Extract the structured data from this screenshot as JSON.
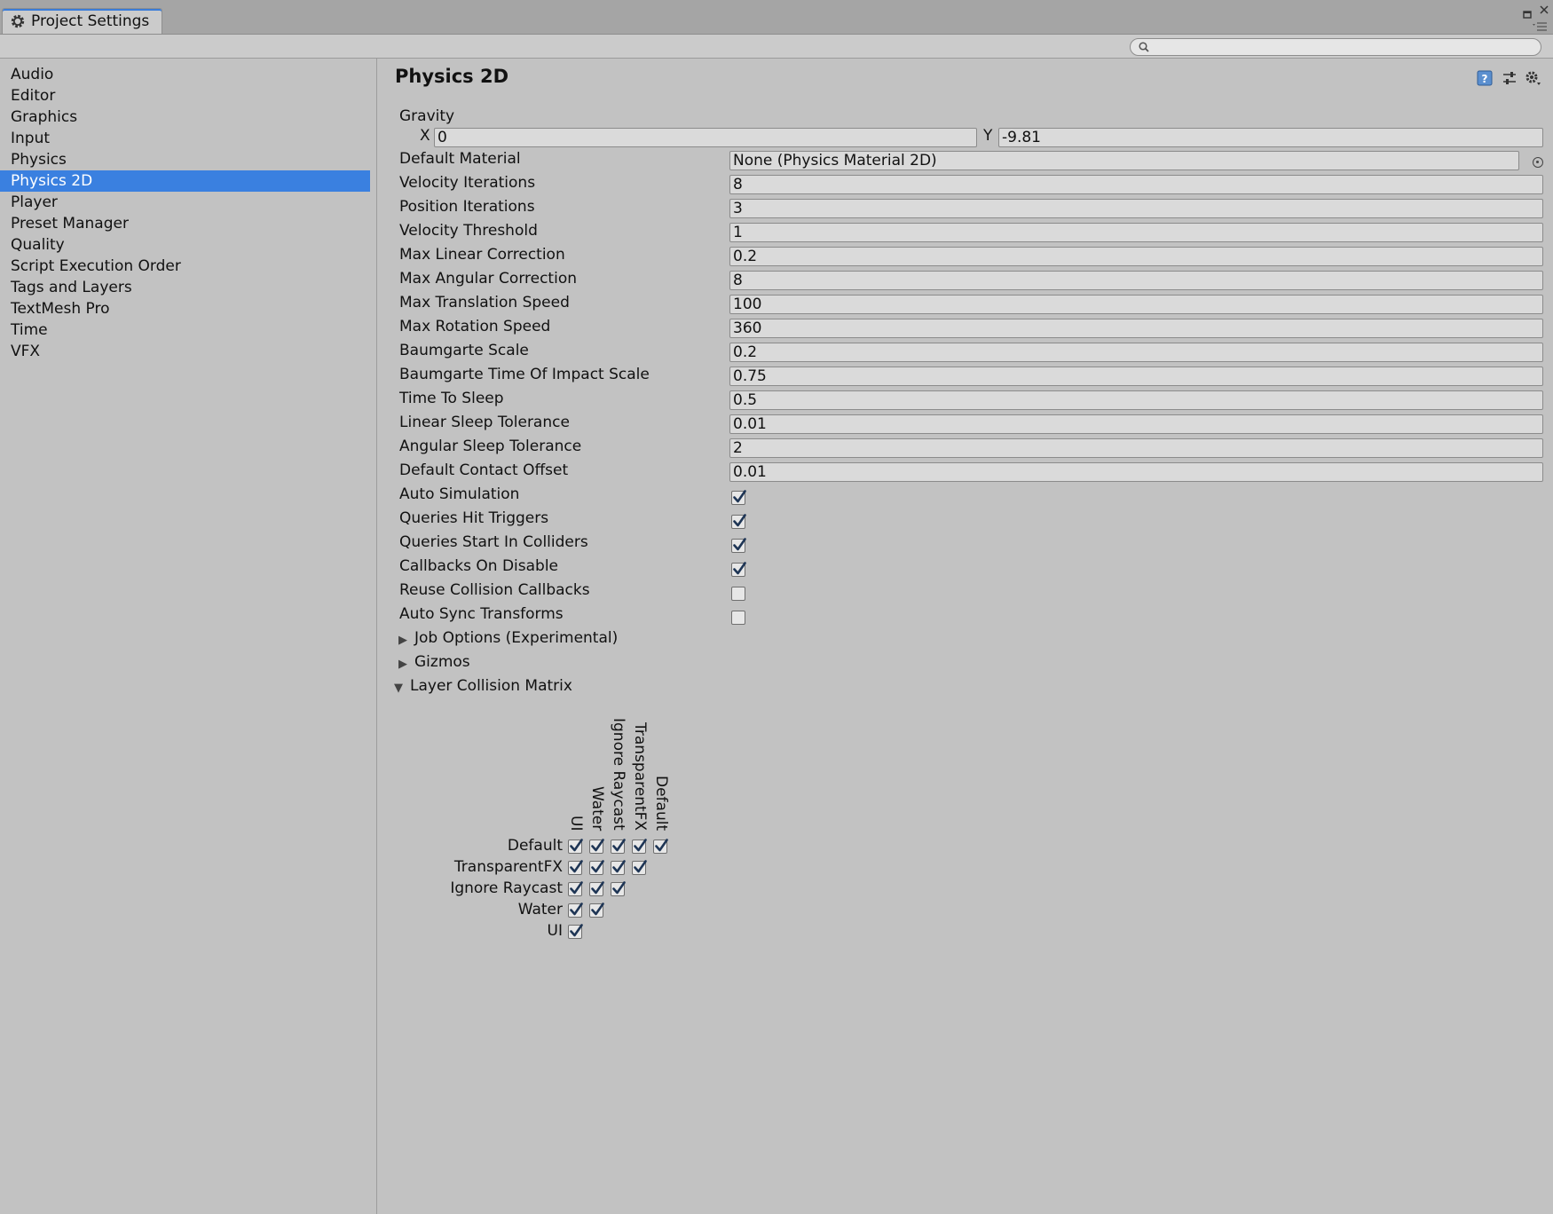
{
  "window": {
    "tab_title": "Project Settings",
    "search": {
      "value": "",
      "placeholder": ""
    }
  },
  "sidebar": {
    "items": [
      {
        "label": "Audio",
        "selected": false
      },
      {
        "label": "Editor",
        "selected": false
      },
      {
        "label": "Graphics",
        "selected": false
      },
      {
        "label": "Input",
        "selected": false
      },
      {
        "label": "Physics",
        "selected": false
      },
      {
        "label": "Physics 2D",
        "selected": true
      },
      {
        "label": "Player",
        "selected": false
      },
      {
        "label": "Preset Manager",
        "selected": false
      },
      {
        "label": "Quality",
        "selected": false
      },
      {
        "label": "Script Execution Order",
        "selected": false
      },
      {
        "label": "Tags and Layers",
        "selected": false
      },
      {
        "label": "TextMesh Pro",
        "selected": false
      },
      {
        "label": "Time",
        "selected": false
      },
      {
        "label": "VFX",
        "selected": false
      }
    ]
  },
  "page": {
    "title": "Physics 2D",
    "header_icons": [
      "help-icon",
      "presets-icon",
      "settings-gear-icon"
    ],
    "gravity": {
      "label": "Gravity",
      "x_label": "X",
      "x_value": "0",
      "y_label": "Y",
      "y_value": "-9.81"
    },
    "default_material": {
      "label": "Default Material",
      "value": "None (Physics Material 2D)"
    },
    "fields": [
      {
        "label": "Velocity Iterations",
        "value": "8"
      },
      {
        "label": "Position Iterations",
        "value": "3"
      },
      {
        "label": "Velocity Threshold",
        "value": "1"
      },
      {
        "label": "Max Linear Correction",
        "value": "0.2"
      },
      {
        "label": "Max Angular Correction",
        "value": "8"
      },
      {
        "label": "Max Translation Speed",
        "value": "100"
      },
      {
        "label": "Max Rotation Speed",
        "value": "360"
      },
      {
        "label": "Baumgarte Scale",
        "value": "0.2"
      },
      {
        "label": "Baumgarte Time Of Impact Scale",
        "value": "0.75"
      },
      {
        "label": "Time To Sleep",
        "value": "0.5"
      },
      {
        "label": "Linear Sleep Tolerance",
        "value": "0.01"
      },
      {
        "label": "Angular Sleep Tolerance",
        "value": "2"
      },
      {
        "label": "Default Contact Offset",
        "value": "0.01"
      }
    ],
    "toggles": [
      {
        "label": "Auto Simulation",
        "checked": true
      },
      {
        "label": "Queries Hit Triggers",
        "checked": true
      },
      {
        "label": "Queries Start In Colliders",
        "checked": true
      },
      {
        "label": "Callbacks On Disable",
        "checked": true
      },
      {
        "label": "Reuse Collision Callbacks",
        "checked": false
      },
      {
        "label": "Auto Sync Transforms",
        "checked": false
      }
    ],
    "foldouts": [
      {
        "label": "Job Options (Experimental)",
        "expanded": false
      },
      {
        "label": "Gizmos",
        "expanded": false
      },
      {
        "label": "Layer Collision Matrix",
        "expanded": true
      }
    ],
    "collision_matrix": {
      "column_labels": [
        "UI",
        "Water",
        "Ignore Raycast",
        "TransparentFX",
        "Default"
      ],
      "rows": [
        {
          "label": "Default",
          "checks": [
            true,
            true,
            true,
            true,
            true
          ]
        },
        {
          "label": "TransparentFX",
          "checks": [
            true,
            true,
            true,
            true
          ]
        },
        {
          "label": "Ignore Raycast",
          "checks": [
            true,
            true,
            true
          ]
        },
        {
          "label": "Water",
          "checks": [
            true,
            true
          ]
        },
        {
          "label": "UI",
          "checks": [
            true
          ]
        }
      ]
    }
  }
}
